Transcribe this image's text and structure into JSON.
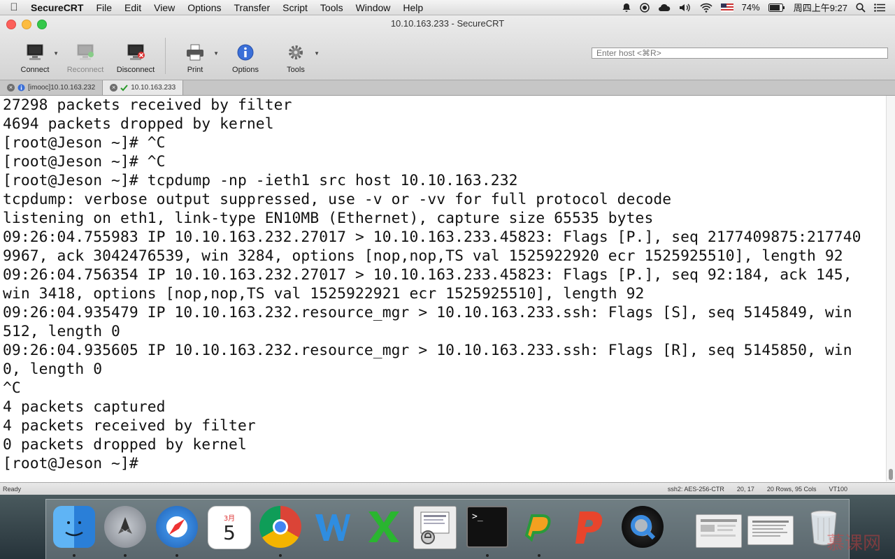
{
  "menubar": {
    "app_name": "SecureCRT",
    "items": [
      "File",
      "Edit",
      "View",
      "Options",
      "Transfer",
      "Script",
      "Tools",
      "Window",
      "Help"
    ],
    "battery": "74%",
    "clock": "周四上午9:27"
  },
  "window": {
    "title": "10.10.163.233 - SecureCRT"
  },
  "toolbar": {
    "connect": "Connect",
    "reconnect": "Reconnect",
    "disconnect": "Disconnect",
    "print": "Print",
    "options": "Options",
    "tools": "Tools",
    "host_placeholder": "Enter host <⌘R>"
  },
  "tabs": [
    {
      "label": "[imooc]10.10.163.232",
      "active": false
    },
    {
      "label": "10.10.163.233",
      "active": true
    }
  ],
  "terminal": {
    "lines": [
      "27298 packets received by filter",
      "4694 packets dropped by kernel",
      "[root@Jeson ~]# ^C",
      "[root@Jeson ~]# ^C",
      "[root@Jeson ~]# tcpdump -np -ieth1 src host 10.10.163.232",
      "tcpdump: verbose output suppressed, use -v or -vv for full protocol decode",
      "listening on eth1, link-type EN10MB (Ethernet), capture size 65535 bytes",
      "09:26:04.755983 IP 10.10.163.232.27017 > 10.10.163.233.45823: Flags [P.], seq 2177409875:217740",
      "9967, ack 3042476539, win 3284, options [nop,nop,TS val 1525922920 ecr 1525925510], length 92",
      "09:26:04.756354 IP 10.10.163.232.27017 > 10.10.163.233.45823: Flags [P.], seq 92:184, ack 145,",
      "win 3418, options [nop,nop,TS val 1525922921 ecr 1525925510], length 92",
      "09:26:04.935479 IP 10.10.163.232.resource_mgr > 10.10.163.233.ssh: Flags [S], seq 5145849, win",
      "512, length 0",
      "09:26:04.935605 IP 10.10.163.232.resource_mgr > 10.10.163.233.ssh: Flags [R], seq 5145850, win",
      "0, length 0",
      "^C",
      "4 packets captured",
      "4 packets received by filter",
      "0 packets dropped by kernel",
      "[root@Jeson ~]#"
    ]
  },
  "statusbar": {
    "ready": "Ready",
    "cipher": "ssh2: AES-256-CTR",
    "position": "20, 17",
    "size": "20 Rows, 95 Cols",
    "emulation": "VT100"
  },
  "dock": {
    "calendar_month": "3月",
    "calendar_day": "5",
    "terminal_prompt": ">_",
    "watermark": "慕课网"
  }
}
